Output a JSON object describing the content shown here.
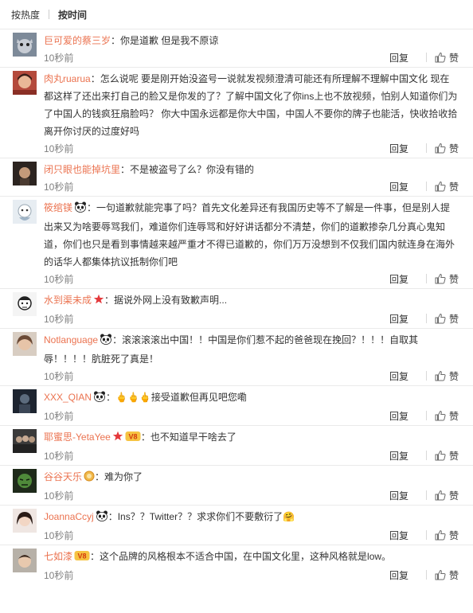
{
  "sort": {
    "hot": "按热度",
    "time": "按时间"
  },
  "meta_labels": {
    "reply": "回复",
    "like": "赞"
  },
  "comments": [
    {
      "user": "巨可爱的蔡三岁",
      "text": "你是道歉  但是我不原谅",
      "time": "10秒前",
      "avatar": "cat-cartoon-avatar",
      "badges": []
    },
    {
      "user": "肉丸ruarua",
      "text": "怎么说呢 要是刚开始没盗号一说就发视频澄清可能还有所理解不理解中国文化 现在都这样了还出来打自己的脸又是你发的了？了解中国文化了你ins上也不放视频，怕别人知道你们为了中国人的钱疯狂扇脸吗？ 你大中国永远都是你大中国，中国人不要你的牌子也能活，快收拾收拾离开你讨厌的过度好吗",
      "time": "10秒前",
      "avatar": "girl-photo-avatar",
      "badges": []
    },
    {
      "user": "闭只眼也能掉坑里",
      "text": "不是被盗号了么？你没有错的",
      "time": "10秒前",
      "avatar": "dark-portrait-avatar",
      "badges": []
    },
    {
      "user": "筱绾镁",
      "text": "一句道歉就能完事了吗？首先文化差异还有我国历史等不了解是一件事，但是别人提出来又为啥要辱骂我们，难道你们连辱骂和好好讲话都分不清楚，你们的道歉掺杂几分真心鬼知道，你们也只是看到事情越来越严重才不得已道歉的，你们万万没想到不仅我们国内就连身在海外的话华人都集体抗议抵制你们吧",
      "time": "10秒前",
      "avatar": "light-cartoon-avatar",
      "badges": [
        "panda-icon"
      ]
    },
    {
      "user": "水到渠未成",
      "text": "据说外网上没有致歉声明...",
      "time": "10秒前",
      "avatar": "sketch-face-avatar",
      "badges": [
        "red-star-icon"
      ]
    },
    {
      "user": "Notlanguage",
      "text": "滚滚滚滚出中国！！中国是你们惹不起的爸爸现在挽回？！！！自取其辱！！！！肮脏死了真是！",
      "time": "10秒前",
      "avatar": "woman-photo-avatar",
      "badges": [
        "panda-icon"
      ]
    },
    {
      "user": "XXX_QIAN",
      "text": "接受道歉但再见吧您嘞",
      "time": "10秒前",
      "avatar": "dark-figure-avatar",
      "badges": [
        "panda-icon"
      ],
      "emoji": "🖕🖕🖕"
    },
    {
      "user": "耶蜜思-YetaYee",
      "text": "也不知道早干啥去了",
      "time": "10秒前",
      "avatar": "band-photo-avatar",
      "badges": [
        "red-star-icon",
        "vip-icon"
      ]
    },
    {
      "user": "谷谷天乐",
      "text": "难为你了",
      "time": "10秒前",
      "avatar": "hulk-avatar",
      "badges": [
        "gold-badge-icon"
      ]
    },
    {
      "user": "JoannaCcyj",
      "text": "Ins？？Twitter？？求求你们不要敷衍了",
      "time": "10秒前",
      "avatar": "girl-face-avatar",
      "badges": [
        "panda-icon"
      ],
      "trailing_emoji": "🤗"
    },
    {
      "user": "七如漆",
      "text": "这个品牌的风格根本不适合中国，在中国文化里，这种风格就是low。",
      "time": "10秒前",
      "avatar": "child-photo-avatar",
      "badges": [
        "vip-icon"
      ]
    }
  ],
  "colors": {
    "username": "#eb7350",
    "time": "#808080",
    "divider": "#eaeaea"
  }
}
